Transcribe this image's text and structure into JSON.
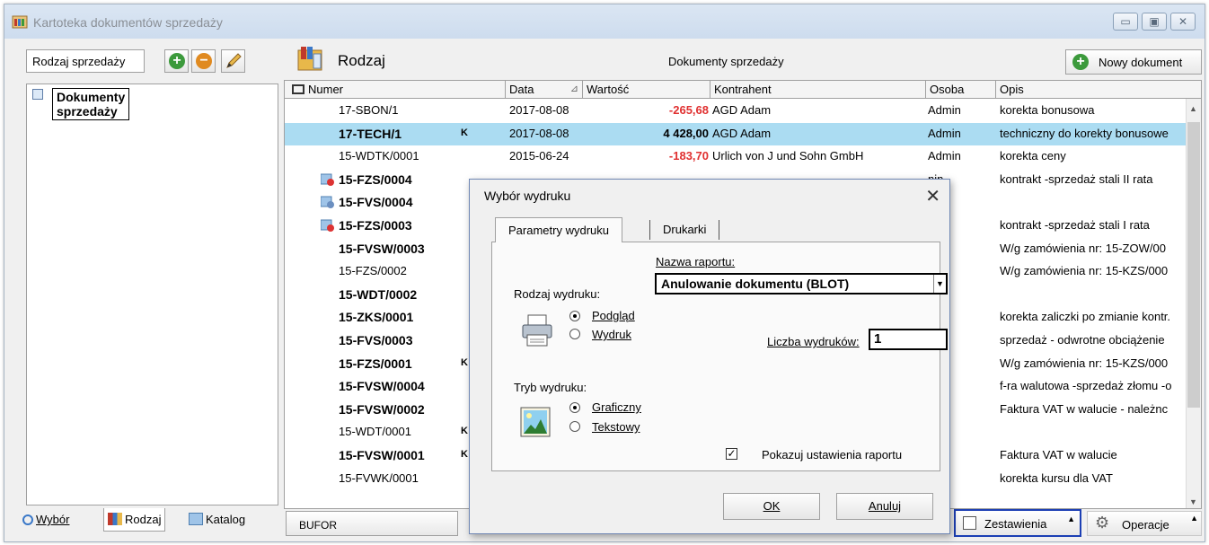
{
  "window": {
    "title": "Kartoteka dokumentów sprzedaży",
    "controls": {
      "minimize": "▭",
      "maximize": "▣",
      "close": "✕"
    }
  },
  "left_panel": {
    "combo_label": "Rodzaj sprzedaży",
    "tree_root": "Dokumenty sprzedaży",
    "tabs": {
      "wybor": "Wybór",
      "rodzaj": "Rodzaj",
      "katalog": "Katalog"
    }
  },
  "main": {
    "kind_label": "Rodzaj",
    "title": "Dokumenty sprzedaży",
    "new_document": "Nowy dokument",
    "columns": {
      "numer": "Numer",
      "data": "Data",
      "wartosc": "Wartość",
      "kontrahent": "Kontrahent",
      "osoba": "Osoba",
      "opis": "Opis"
    },
    "rows": [
      {
        "numer": "17-SBON/1",
        "flag": "",
        "data": "2017-08-08",
        "wartosc": "-265,68",
        "kontrahent": "AGD Adam",
        "osoba": "Admin",
        "opis": "korekta bonusowa"
      },
      {
        "numer": "17-TECH/1",
        "flag": "K",
        "data": "2017-08-08",
        "wartosc": "4 428,00",
        "kontrahent": "AGD Adam",
        "osoba": "Admin",
        "opis": "techniczny do korekty bonusowe"
      },
      {
        "numer": "15-WDTK/0001",
        "flag": "",
        "data": "2015-06-24",
        "wartosc": "-183,70",
        "kontrahent": "Urlich von J und Sohn GmbH",
        "osoba": "Admin",
        "opis": "korekta ceny"
      },
      {
        "numer": "15-FZS/0004",
        "flag": "",
        "osoba": "nin",
        "opis": "kontrakt -sprzedaż stali II rata"
      },
      {
        "numer": "15-FVS/0004",
        "flag": "",
        "osoba": "nin",
        "opis": ""
      },
      {
        "numer": "15-FZS/0003",
        "flag": "",
        "osoba": "nin",
        "opis": "kontrakt -sprzedaż stali I rata"
      },
      {
        "numer": "15-FVSW/0003",
        "flag": "",
        "osoba": "nin",
        "opis": "W/g zamówienia nr: 15-ZOW/00"
      },
      {
        "numer": "15-FZS/0002",
        "flag": "",
        "osoba": "nin",
        "opis": "W/g zamówienia nr: 15-KZS/000"
      },
      {
        "numer": "15-WDT/0002",
        "flag": "",
        "osoba": "nin",
        "opis": ""
      },
      {
        "numer": "15-ZKS/0001",
        "flag": "",
        "osoba": "nin",
        "opis": "korekta zaliczki po zmianie kontr."
      },
      {
        "numer": "15-FVS/0003",
        "flag": "",
        "osoba": "nin",
        "opis": "sprzedaż - odwrotne obciążenie"
      },
      {
        "numer": "15-FZS/0001",
        "flag": "K",
        "osoba": "nin",
        "opis": "W/g zamówienia nr: 15-KZS/000"
      },
      {
        "numer": "15-FVSW/0004",
        "flag": "",
        "osoba": "nin",
        "opis": "f-ra walutowa -sprzedaż złomu -o"
      },
      {
        "numer": "15-FVSW/0002",
        "flag": "",
        "osoba": "nin",
        "opis": "Faktura VAT w walucie - należnc"
      },
      {
        "numer": "15-WDT/0001",
        "flag": "K",
        "osoba": "nin",
        "opis": ""
      },
      {
        "numer": "15-FVSW/0001",
        "flag": "K",
        "osoba": "nin",
        "opis": "Faktura VAT w walucie"
      },
      {
        "numer": "15-FVWK/0001",
        "flag": "",
        "osoba": "nin",
        "opis": "korekta kursu dla VAT"
      }
    ],
    "bufor": "BUFOR",
    "zestawienia": "Zestawienia",
    "operacje": "Operacje"
  },
  "dialog": {
    "title": "Wybór wydruku",
    "tabs": {
      "params": "Parametry wydruku",
      "printers": "Drukarki"
    },
    "report_name_label": "Nazwa raportu:",
    "report_name_value": "Anulowanie dokumentu (BLOT)",
    "print_kind_label": "Rodzaj wydruku:",
    "preview": "Podgląd",
    "print": "Wydruk",
    "copies_label": "Liczba wydruków:",
    "copies_value": "1",
    "mode_label": "Tryb wydruku:",
    "graphic": "Graficzny",
    "text": "Tekstowy",
    "show_settings": "Pokazuj ustawienia raportu",
    "ok": "OK",
    "cancel": "Anuluj"
  },
  "colors": {
    "selection": "#abdcf2",
    "negative": "#e03030",
    "accent_border": "#1c3fb4",
    "add_green": "#3c9a3c",
    "remove_orange": "#e08a20"
  }
}
